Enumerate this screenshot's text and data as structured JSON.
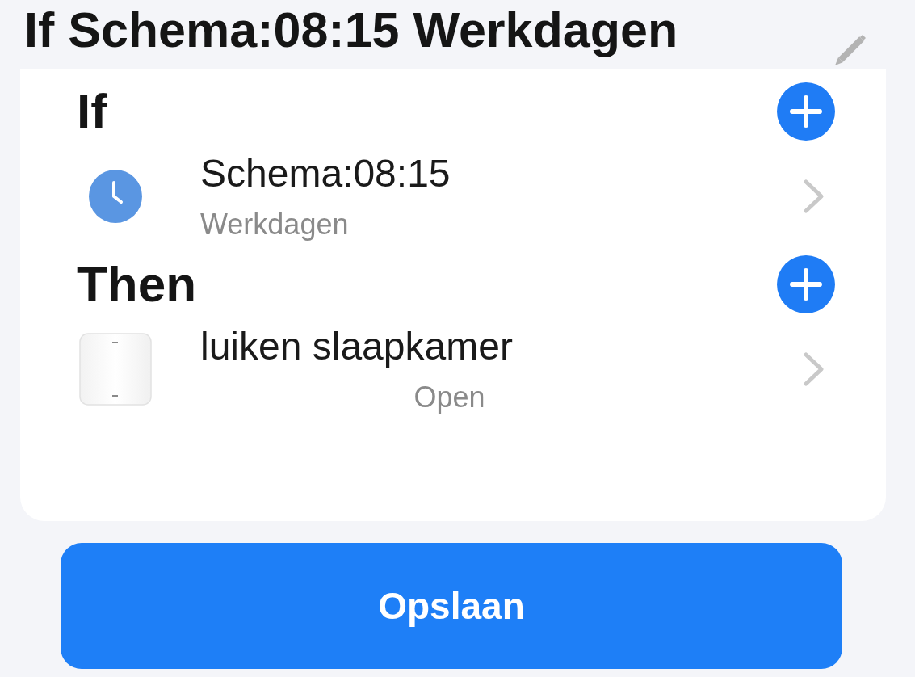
{
  "header": {
    "title": "If Schema:08:15 Werkdagen"
  },
  "sections": [
    {
      "heading": "If",
      "items": [
        {
          "kind": "schedule",
          "title": "Schema:08:15",
          "subtitle": "Werkdagen"
        }
      ]
    },
    {
      "heading": "Then",
      "items": [
        {
          "kind": "device",
          "title": "luiken slaapkamer",
          "subtitle": "Open"
        }
      ]
    }
  ],
  "save_button": {
    "label": "Opslaan"
  }
}
